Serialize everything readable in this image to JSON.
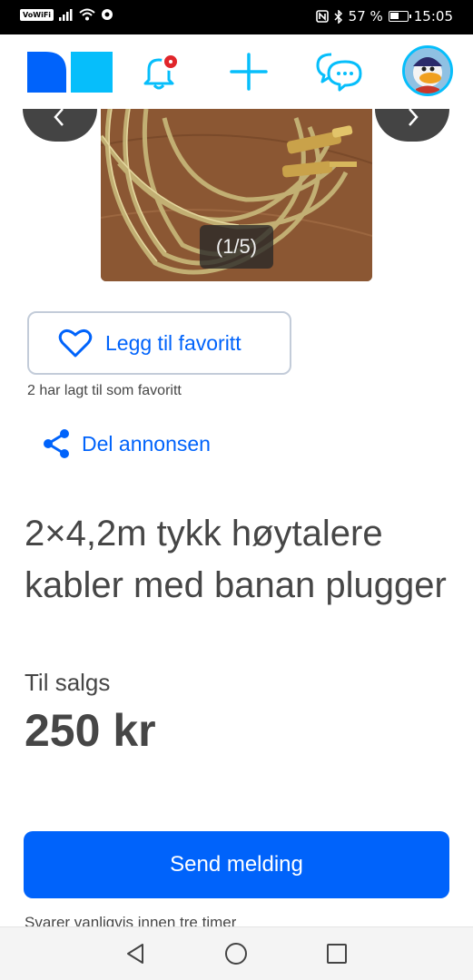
{
  "status_bar": {
    "vowifi": "VoWiFi",
    "battery_text": "57 %",
    "battery_level": 0.57,
    "time": "15:05"
  },
  "header": {
    "icons": [
      "logo-icon",
      "bell-icon",
      "plus-icon",
      "chat-icon",
      "avatar"
    ],
    "accent": "#0063fb",
    "icon_color": "#06befb",
    "notification_color": "#e0252a"
  },
  "gallery": {
    "counter": "(1/5)",
    "prev_icon": "chevron-left-icon",
    "next_icon": "chevron-right-icon"
  },
  "favorite": {
    "label": "Legg til favoritt",
    "count_text": "2 har lagt til som favoritt"
  },
  "share": {
    "label": "Del annonsen"
  },
  "listing": {
    "title": "2×4,2m tykk høytalere kabler med banan plugger",
    "status": "Til salgs",
    "price": "250 kr"
  },
  "contact": {
    "send_label": "Send melding",
    "reply_note": "Svarer vanligvis innen tre timer"
  },
  "android_nav": [
    "back-icon",
    "home-icon",
    "recents-icon"
  ]
}
